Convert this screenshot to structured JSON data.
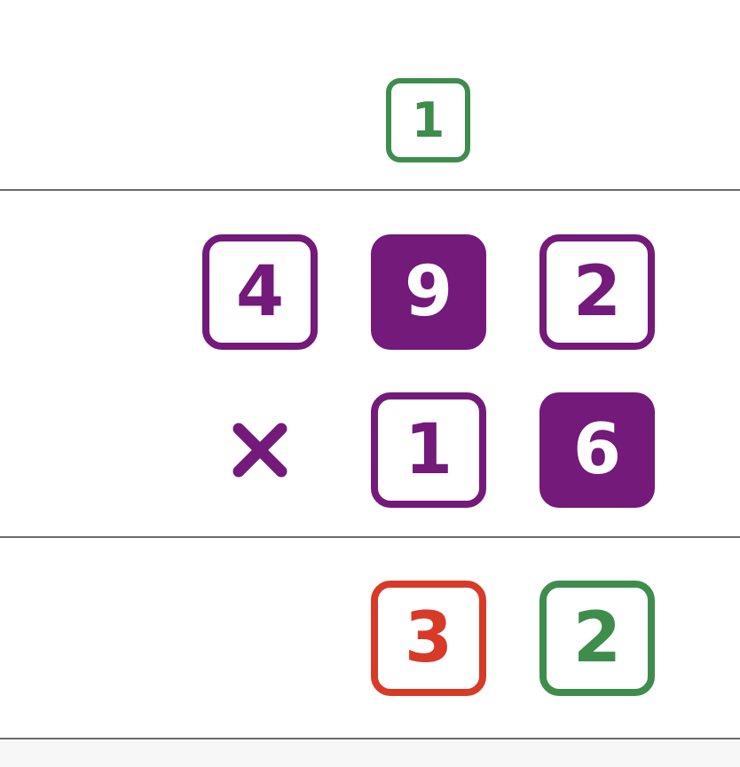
{
  "colors": {
    "purple": "#731a7a",
    "green": "#3f8d4c",
    "red": "#d73b28",
    "rule": "#6b6b6b",
    "white": "#ffffff"
  },
  "carry": {
    "digit": "1",
    "color": "#3f8d4c",
    "style": "outline"
  },
  "multiplicand": {
    "digits": [
      "4",
      "9",
      "2"
    ],
    "styles": [
      "outline",
      "filled",
      "outline"
    ]
  },
  "multiplier": {
    "operator_icon": "multiply-icon",
    "digits": [
      "1",
      "6"
    ],
    "styles": [
      "outline",
      "filled"
    ]
  },
  "result": {
    "digits": [
      "3",
      "2"
    ],
    "colors": [
      "#d73b28",
      "#3f8d4c"
    ],
    "styles": [
      "outline",
      "outline"
    ]
  }
}
